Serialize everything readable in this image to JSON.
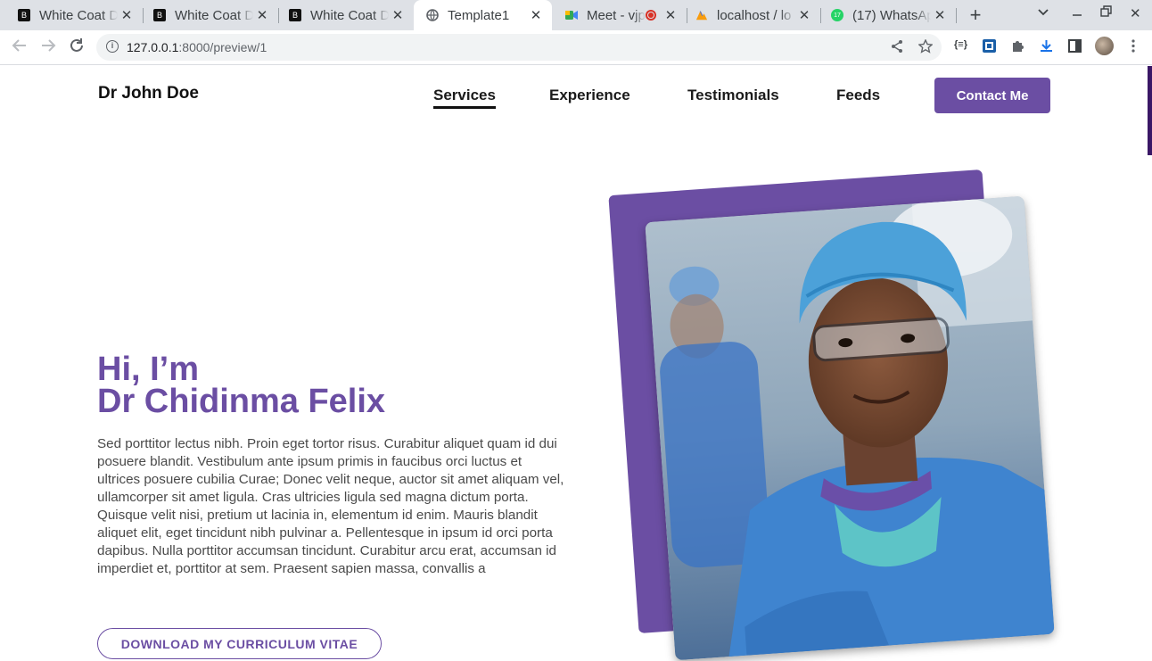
{
  "browser": {
    "tabs": [
      {
        "title": "White Coat D",
        "favicon": "B",
        "active": false
      },
      {
        "title": "White Coat D",
        "favicon": "B",
        "active": false
      },
      {
        "title": "White Coat D",
        "favicon": "B",
        "active": false
      },
      {
        "title": "Template1",
        "favicon": "globe",
        "active": true
      },
      {
        "title": "Meet - vjp",
        "favicon": "meet",
        "active": false
      },
      {
        "title": "localhost / lo",
        "favicon": "pma",
        "active": false
      },
      {
        "title": "(17) WhatsAp",
        "favicon": "whatsapp",
        "active": false
      }
    ],
    "url_host": "127.0.0.1",
    "url_path": ":8000/preview/1"
  },
  "site": {
    "brand": "Dr John Doe",
    "nav": [
      "Services",
      "Experience",
      "Testimonials",
      "Feeds"
    ],
    "contact_label": "Contact Me",
    "greeting": "Hi, I’m",
    "name": "Dr Chidinma Felix",
    "bio": "Sed porttitor lectus nibh. Proin eget tortor risus. Curabitur aliquet quam id dui posuere blandit. Vestibulum ante ipsum primis in faucibus orci luctus et ultrices posuere cubilia Curae; Donec velit neque, auctor sit amet aliquam vel, ullamcorper sit amet ligula. Cras ultricies ligula sed magna dictum porta. Quisque velit nisi, pretium ut lacinia in, elementum id enim. Mauris blandit aliquet elit, eget tincidunt nibh pulvinar a. Pellentesque in ipsum id orci porta dapibus. Nulla porttitor accumsan tincidunt. Curabitur arcu erat, accumsan id imperdiet et, porttitor at sem. Praesent sapien massa, convallis a",
    "cv_label": "DOWNLOAD MY CURRICULUM VITAE"
  },
  "colors": {
    "accent": "#6b4ea3",
    "scrollbar": "#3a1766"
  }
}
